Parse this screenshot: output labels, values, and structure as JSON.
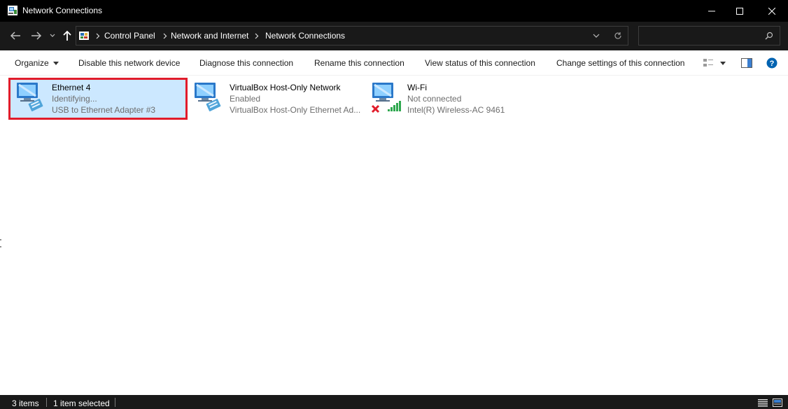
{
  "window": {
    "title": "Network Connections"
  },
  "address": {
    "crumbs": [
      "Control Panel",
      "Network and Internet",
      "Network Connections"
    ],
    "search_placeholder": ""
  },
  "toolbar": {
    "organize": "Organize",
    "disable": "Disable this network device",
    "diagnose": "Diagnose this connection",
    "rename": "Rename this connection",
    "view_status": "View status of this connection",
    "change_settings": "Change settings of this connection"
  },
  "connections": [
    {
      "name": "Ethernet 4",
      "status": "Identifying...",
      "device": "USB to Ethernet Adapter #3",
      "icon": "ethernet-adapter-icon",
      "selected": true
    },
    {
      "name": "VirtualBox Host-Only Network",
      "status": "Enabled",
      "device": "VirtualBox Host-Only Ethernet Ad...",
      "icon": "ethernet-adapter-icon",
      "selected": false
    },
    {
      "name": "Wi-Fi",
      "status": "Not connected",
      "device": "Intel(R) Wireless-AC 9461",
      "icon": "wifi-adapter-icon",
      "selected": false
    }
  ],
  "statusbar": {
    "item_count": "3 items",
    "selection": "1 item selected"
  },
  "colors": {
    "selection_fill": "#cce8ff",
    "selection_outline": "#e11c2b",
    "title_bar": "#000000",
    "address_bar": "#191919",
    "secondary_text": "#6d6d6d",
    "help_blue": "#0063b1",
    "error_red": "#e11c2b",
    "signal_green": "#2fa84f"
  }
}
